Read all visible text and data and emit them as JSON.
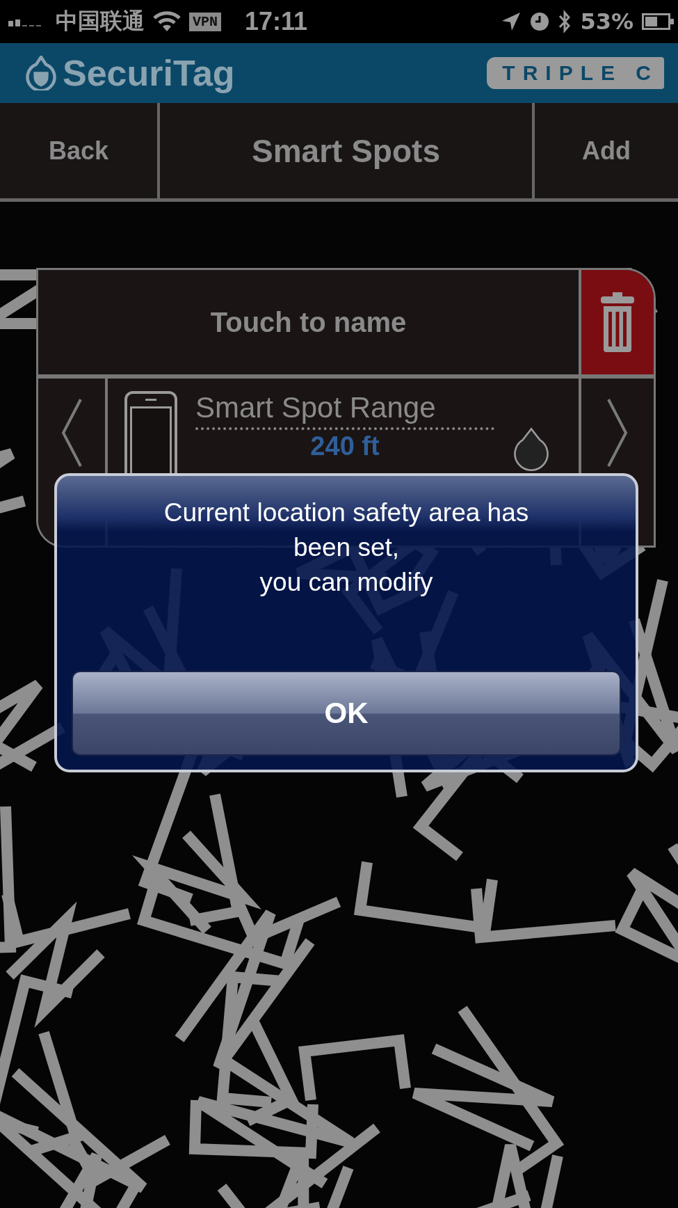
{
  "status_bar": {
    "carrier": "中国联通",
    "vpn": "VPN",
    "time": "17:11",
    "battery": "53%"
  },
  "header": {
    "app_name": "SecuriTag",
    "badge": "TRIPLE C"
  },
  "nav": {
    "back": "Back",
    "title": "Smart Spots",
    "add": "Add"
  },
  "spot": {
    "name_prompt": "Touch to name",
    "range": {
      "label": "Smart Spot Range",
      "value": "240 ft"
    }
  },
  "alert": {
    "message_lines": [
      "Current location safety area has",
      "been set,",
      "you can modify"
    ],
    "button": "OK"
  }
}
